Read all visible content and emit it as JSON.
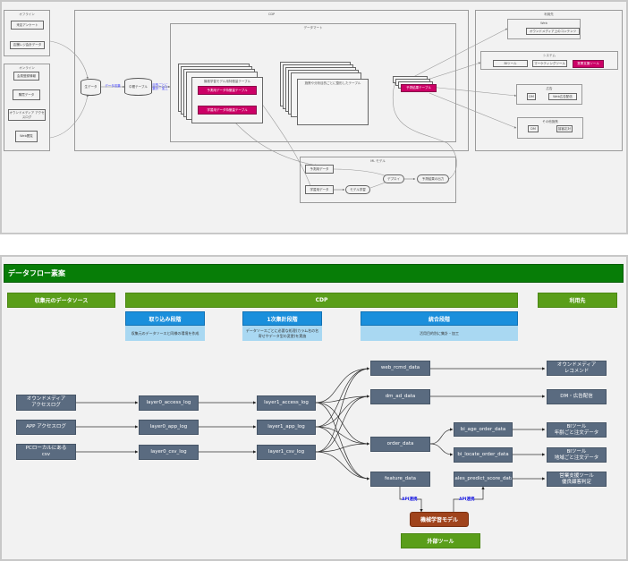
{
  "top_diagram": {
    "offline_group": {
      "title": "オフライン",
      "items": [
        "来店アンケート",
        "店舗レジ会計データ"
      ]
    },
    "online_group": {
      "title": "オンライン",
      "items": [
        "会員登録情報",
        "購買データ",
        "オウンドメディア アクセスログ",
        "Web閲覧"
      ]
    },
    "raw_data": "生データ",
    "data_lake_edge": "データ収集",
    "middle_table": "中間テーブル",
    "middle_edge": "目的ごとに 集計・加工",
    "cdp_title": "CDP",
    "datamart_title": "データマート",
    "ml_stack_title": "機械学習モデル用特徴量テーブル",
    "ml_stack_items": [
      "予測用データ特徴量テーブル",
      "学習用データ特徴量テーブル"
    ],
    "analysis_stack_title": "施策や分析目的ごとに整形したテーブル",
    "prediction_table": "予測結果テーブル",
    "usage_title": "利用先",
    "web_group": {
      "title": "Web",
      "items": [
        "オウンドメディア上のコンテンツ"
      ]
    },
    "system_group": {
      "title": "システム",
      "items": [
        "BIツール",
        "マーケティングツール",
        "営業支援ツール"
      ]
    },
    "ad_group": {
      "title": "広告",
      "items": [
        "DM",
        "Web広告配信"
      ]
    },
    "other_group": {
      "title": "その他施策",
      "items": [
        "DM",
        "接客応対"
      ]
    },
    "ml_group": {
      "title": "ML モデル",
      "nodes": [
        "予測用データ",
        "学習用データ",
        "モデル学習",
        "デプロイ",
        "予測結果の出力"
      ]
    }
  },
  "bottom_diagram": {
    "header": "データフロー素案",
    "columns": {
      "sources": "収集元のデータソース",
      "cdp": "CDP",
      "usage": "利用先"
    },
    "stages": [
      {
        "title": "取り込み段階",
        "desc": "収集元のデータソースと同様の環境を作成"
      },
      {
        "title": "1次集計段階",
        "desc": "データソースごとに必要な処理(カラム名の名寄せやデータ型の変更)を実施"
      },
      {
        "title": "統合段階",
        "desc": "活用目的別に集計・加工"
      }
    ],
    "sources": [
      "オウンドメディア\nアクセスログ",
      "APP アクセスログ",
      "PCローカルにある\ncsv"
    ],
    "layer0": [
      "layer0_access_log",
      "layer0_app_log",
      "layer0_csv_log"
    ],
    "layer1": [
      "layer1_access_log",
      "layer1_app_log",
      "layer1_csv_log"
    ],
    "integrated": [
      "web_rcmd_data",
      "dm_ad_data",
      "order_data",
      "feature_data"
    ],
    "bi": [
      "bi_age_order_data",
      "bi_locate_order_data"
    ],
    "score": "sales_predict_score_data",
    "destinations": [
      "オウンドメディア\nレコメンド",
      "DM・広告配信",
      "BIツール\n年齢ごと注文データ",
      "BIツール\n地域ごと注文データ",
      "営業支援ツール\n優良顧客判定"
    ],
    "ml_model": "機械学習モデル",
    "external_tool": "外部ツール",
    "api_labels": [
      "API連携",
      "API連携"
    ]
  },
  "colors": {
    "header_green": "#077d07",
    "column_green": "#5a9e1a",
    "stage_blue": "#1a8fdc",
    "stage_desc_blue": "#a9d8f2",
    "node_slate": "#5a6b80",
    "ml_brown": "#a0441c",
    "highlight_magenta": "#cc0066",
    "api_blue": "#1515e0"
  }
}
